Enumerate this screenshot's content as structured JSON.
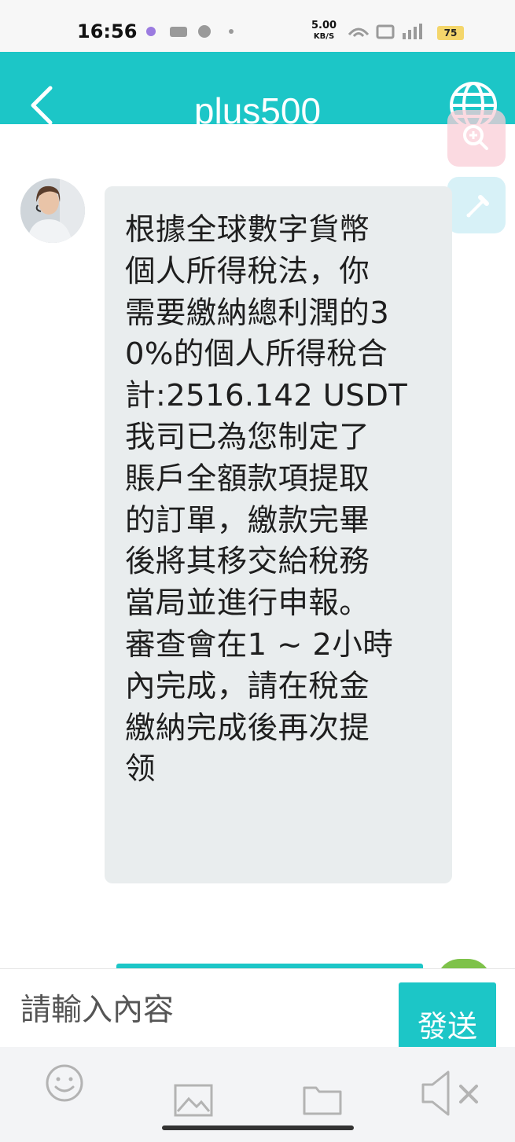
{
  "status_bar": {
    "time": "16:56",
    "net_speed_value": "5.00",
    "net_speed_unit": "KB/S",
    "battery": "75"
  },
  "header": {
    "title": "plus500",
    "back_icon": "chevron-left-icon",
    "globe_icon": "globe-icon"
  },
  "floating_tools": {
    "zoom_icon": "magnifier-plus-icon",
    "pipette_icon": "pipette-icon",
    "zoom_color": "#f9cdd7",
    "pipette_color": "#cdeef5"
  },
  "chat": {
    "messages": [
      {
        "sender": "agent",
        "lines": [
          "根據全球數字貨幣",
          "個人所得稅法，你",
          "需要繳納總利潤的3",
          "0%的個人所得稅合",
          "計:2516.142 USDT",
          "我司已為您制定了",
          "賬戶全額款項提取",
          "的訂單，繳款完畢",
          "後將其移交給稅務",
          "當局並進行申報。",
          "審查會在1 ~ 2小時",
          "內完成，請在稅金",
          "繳納完成後再次提",
          "领"
        ]
      }
    ]
  },
  "composer": {
    "placeholder": "請輸入內容",
    "send_label": "發送"
  },
  "toolbar": {
    "items": [
      "emoji-icon",
      "image-icon",
      "folder-icon",
      "speaker-muted-icon"
    ]
  },
  "colors": {
    "accent": "#1cc6c7",
    "bubble": "#e9edee",
    "toolbar_bg": "#f3f4f6"
  }
}
